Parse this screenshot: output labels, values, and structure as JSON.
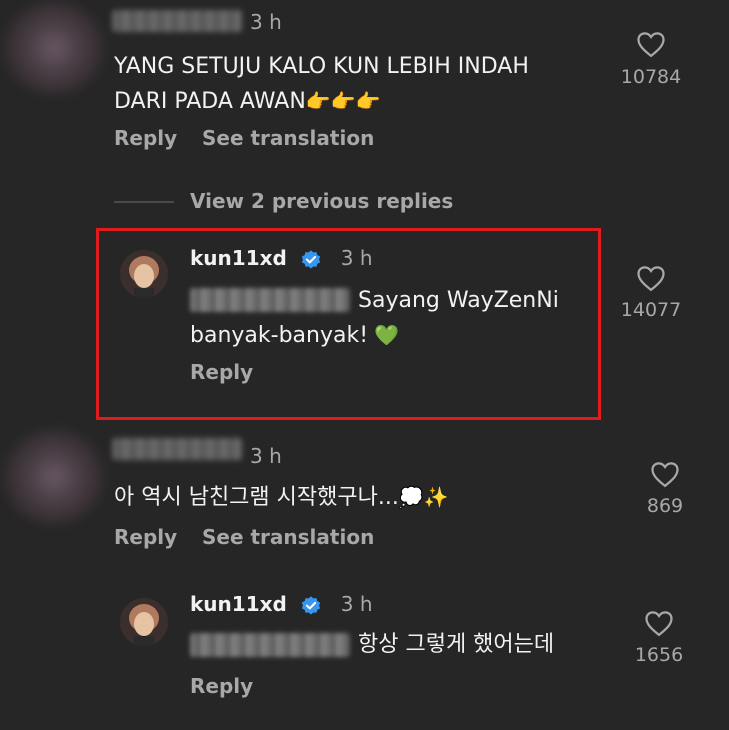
{
  "comments": [
    {
      "time": "3 h",
      "text_line1": "YANG SETUJU KALO KUN LEBIH INDAH",
      "text_line2": "DARI PADA AWAN",
      "emoji": "👉👉👉",
      "like_count": "10784",
      "reply_label": "Reply",
      "translate_label": "See translation"
    },
    {
      "time": "3 h",
      "text": "아 역시 남친그램 시작했구나...",
      "emoji": "💭✨",
      "like_count": "869",
      "reply_label": "Reply",
      "translate_label": "See translation"
    }
  ],
  "view_replies_label": "View 2 previous replies",
  "replies": [
    {
      "username": "kun11xd",
      "time": "3 h",
      "text_after_mention": "Sayang WayZenNi",
      "text_line2": "banyak-banyak!",
      "emoji": "💚",
      "like_count": "14077",
      "reply_label": "Reply"
    },
    {
      "username": "kun11xd",
      "time": "3 h",
      "text_after_mention": "항상 그렇게 했어는데",
      "like_count": "1656",
      "reply_label": "Reply"
    }
  ],
  "colors": {
    "background": "#262626",
    "text": "#f2f2f2",
    "muted": "#a8a8a8",
    "verified": "#3797f0",
    "highlight": "#e01b1b"
  }
}
